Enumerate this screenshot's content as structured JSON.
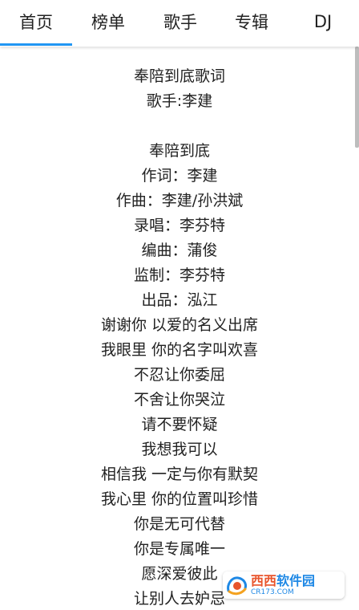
{
  "tabs": {
    "home": "首页",
    "charts": "榜单",
    "singers": "歌手",
    "albums": "专辑",
    "dj": "DJ",
    "active": "home",
    "accent_color": "#2196f3"
  },
  "lyrics": {
    "title": "奉陪到底歌词",
    "singer": "歌手:李建",
    "lines": [
      "奉陪到底",
      "作词：李建",
      "作曲：李建/孙洪斌",
      "录唱：李芬特",
      "编曲：蒲俊",
      "监制：李芬特",
      "出品：泓江",
      "谢谢你 以爱的名义出席",
      "我眼里 你的名字叫欢喜",
      "不忍让你委屈",
      "不舍让你哭泣",
      "请不要怀疑",
      "我想我可以",
      "相信我 一定与你有默契",
      "我心里 你的位置叫珍惜",
      "你是无可代替",
      "你是专属唯一",
      "愿深爱彼此",
      "让别人去妒忌"
    ]
  },
  "watermark": {
    "name_a": "西西",
    "name_b": "软件园",
    "url": "CR173.COM",
    "icon": "xixi-logo-icon"
  }
}
